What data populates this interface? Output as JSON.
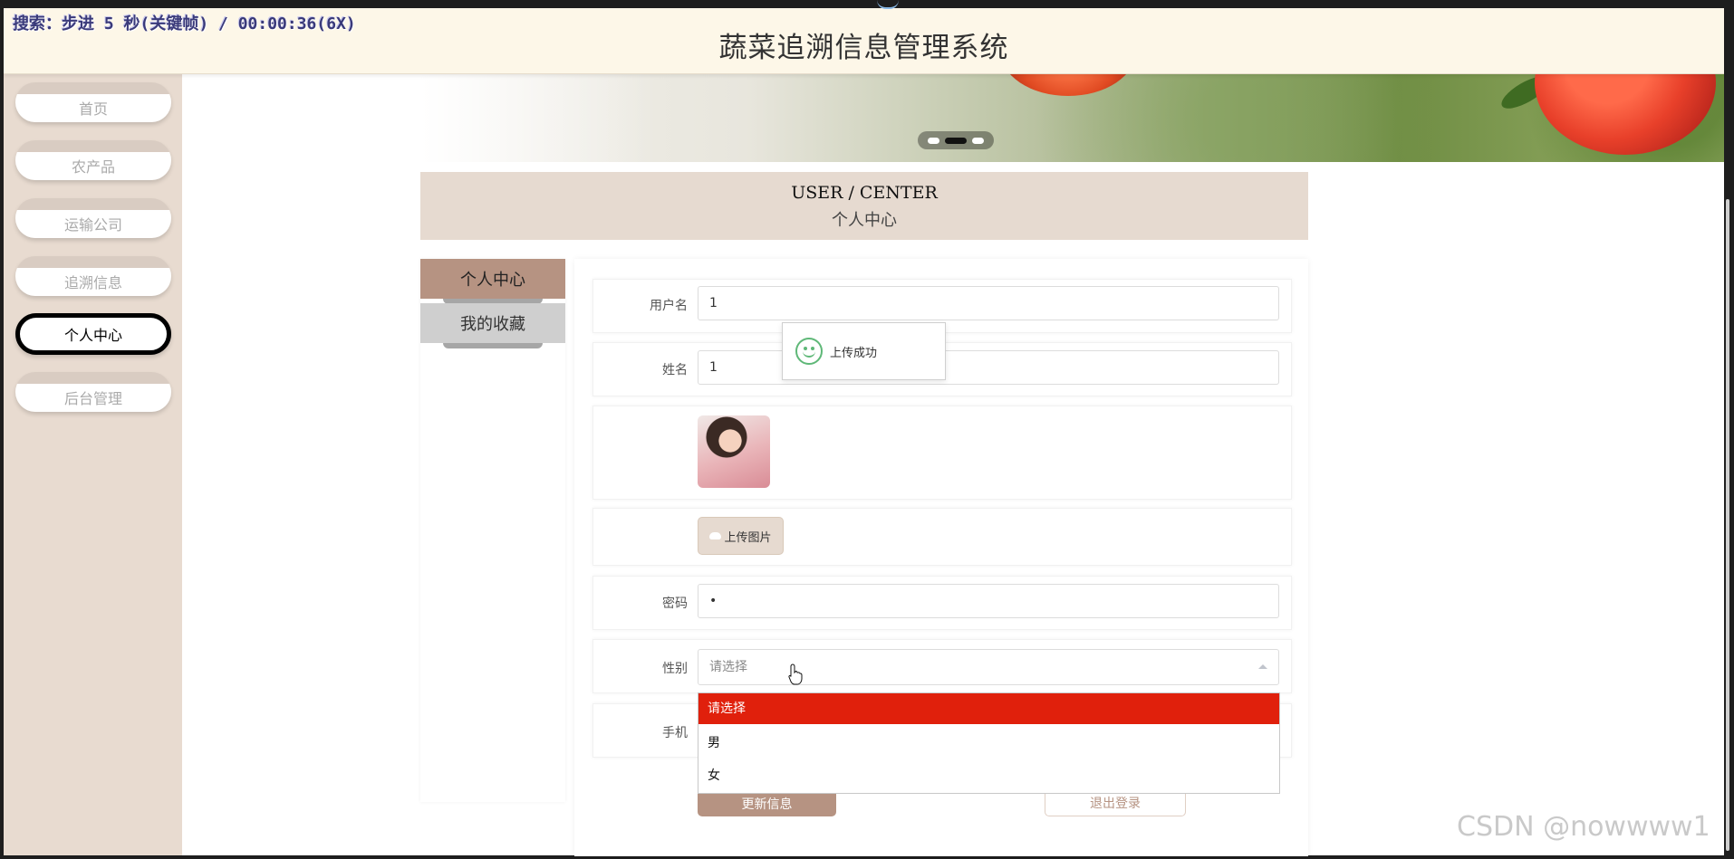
{
  "overlay": {
    "text": "搜索：步进 5 秒(关键帧) / 00:00:36(6X)"
  },
  "header": {
    "title": "蔬菜追溯信息管理系统"
  },
  "sidebar": {
    "items": [
      {
        "label": "首页",
        "active": false
      },
      {
        "label": "农产品",
        "active": false
      },
      {
        "label": "运输公司",
        "active": false
      },
      {
        "label": "追溯信息",
        "active": false
      },
      {
        "label": "个人中心",
        "active": true
      },
      {
        "label": "后台管理",
        "active": false
      }
    ]
  },
  "banner": {
    "slide_count": 3,
    "active_slide": 2
  },
  "user_center": {
    "title_en": "USER / CENTER",
    "title_cn": "个人中心"
  },
  "tabs": [
    {
      "label": "个人中心",
      "active": true
    },
    {
      "label": "我的收藏",
      "active": false
    }
  ],
  "form": {
    "username": {
      "label": "用户名",
      "value": "1"
    },
    "name": {
      "label": "姓名",
      "value": "1"
    },
    "upload_button": "上传图片",
    "password": {
      "label": "密码",
      "value": "•"
    },
    "gender": {
      "label": "性别",
      "placeholder": "请选择",
      "options": [
        "请选择",
        "男",
        "女"
      ],
      "highlighted_option": "请选择"
    },
    "phone": {
      "label": "手机"
    },
    "update_button": "更新信息",
    "logout_button": "退出登录"
  },
  "toast": {
    "message": "上传成功"
  },
  "watermark": "CSDN @nowwww1",
  "colors": {
    "accent": "#b69382",
    "sidebar_bg": "#e8dbd0",
    "header_bg": "#fdf7e8",
    "highlight": "#e0200c",
    "success": "#5fb878"
  }
}
